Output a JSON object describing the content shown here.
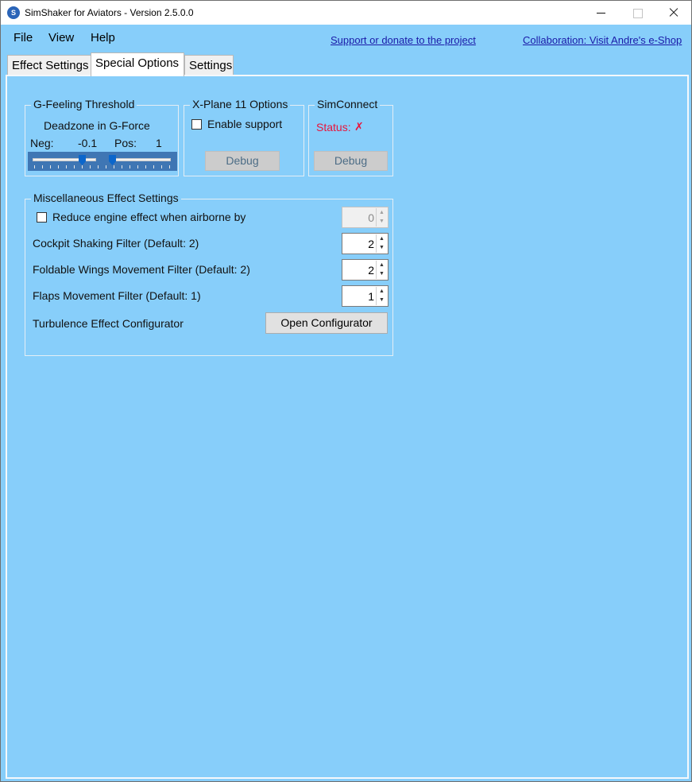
{
  "window": {
    "title": "SimShaker for Aviators  - Version 2.5.0.0"
  },
  "menu": {
    "file": "File",
    "view": "View",
    "help": "Help"
  },
  "links": {
    "support": "Support or donate to the project",
    "shop": "Collaboration: Visit Andre's e-Shop"
  },
  "tabs": [
    {
      "label": "Effect Settings",
      "selected": false
    },
    {
      "label": "Special Options",
      "selected": true
    },
    {
      "label": "Settings",
      "selected": false
    }
  ],
  "g_feeling": {
    "title": "G-Feeling Threshold",
    "subtitle": "Deadzone in G-Force",
    "neg_label": "Neg:",
    "neg_value": "-0.1",
    "pos_label": "Pos:",
    "pos_value": "1"
  },
  "xplane": {
    "title": "X-Plane 11 Options",
    "enable_label": "Enable support",
    "enable_checked": false,
    "debug_label": "Debug"
  },
  "simconnect": {
    "title": "SimConnect",
    "status_label": "Status:",
    "status_value": "✗",
    "status_color": "#e8143c",
    "debug_label": "Debug"
  },
  "misc": {
    "title": "Miscellaneous Effect Settings",
    "reduce_engine": {
      "label": "Reduce engine effect when airborne by",
      "checked": false,
      "value": "0"
    },
    "cockpit_shaking": {
      "label": "Cockpit Shaking Filter (Default: 2)",
      "value": "2"
    },
    "foldable_wings": {
      "label": "Foldable Wings Movement Filter (Default: 2)",
      "value": "2"
    },
    "flaps": {
      "label": "Flaps Movement Filter (Default: 1)",
      "value": "1"
    },
    "turbulence": {
      "label": "Turbulence Effect Configurator",
      "button": "Open Configurator"
    }
  },
  "colors": {
    "background": "#87cefa",
    "link": "#1a1aa8",
    "slider_bg": "#3f76b4",
    "thumb": "#0a66cc"
  }
}
